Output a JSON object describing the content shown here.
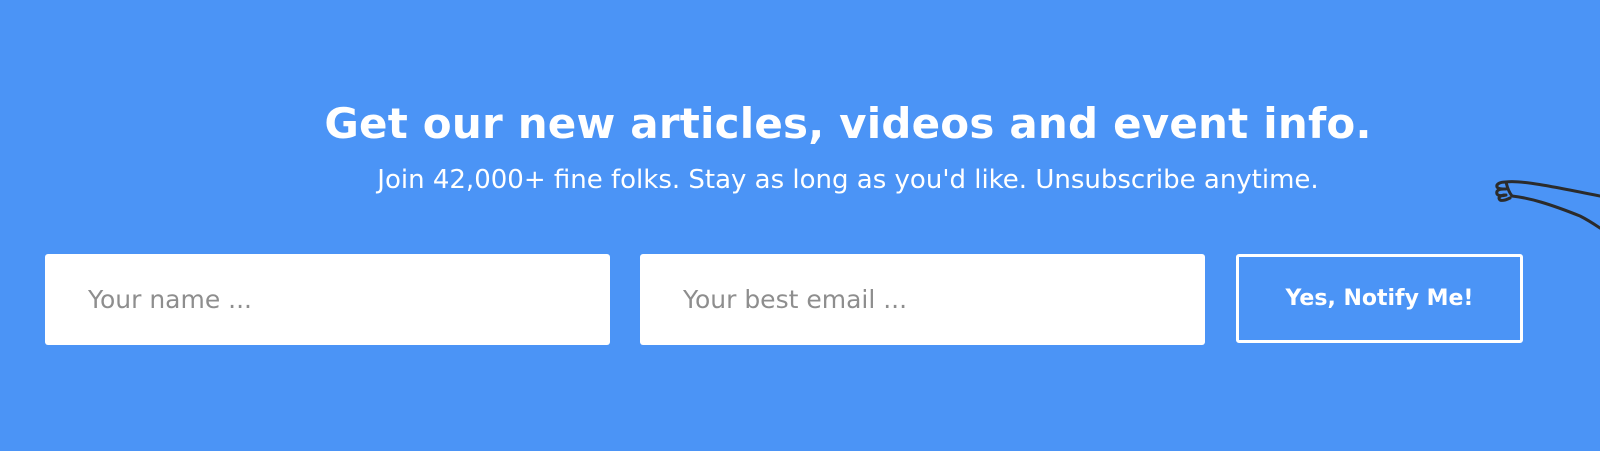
{
  "newsletter": {
    "headline": "Get our new articles, videos and event info.",
    "subtext": "Join 42,000+ fine folks. Stay as long as you'd like. Unsubscribe anytime.",
    "name_placeholder": "Your name ...",
    "email_placeholder": "Your best email ...",
    "submit_label": "Yes, Notify Me!"
  },
  "colors": {
    "background": "#4b94f6",
    "text": "#ffffff",
    "input_background": "#ffffff",
    "placeholder": "#8e8e8e",
    "sketch_line": "#2b2b2b"
  },
  "icons": {
    "decoration": "hand-sketch-icon"
  }
}
